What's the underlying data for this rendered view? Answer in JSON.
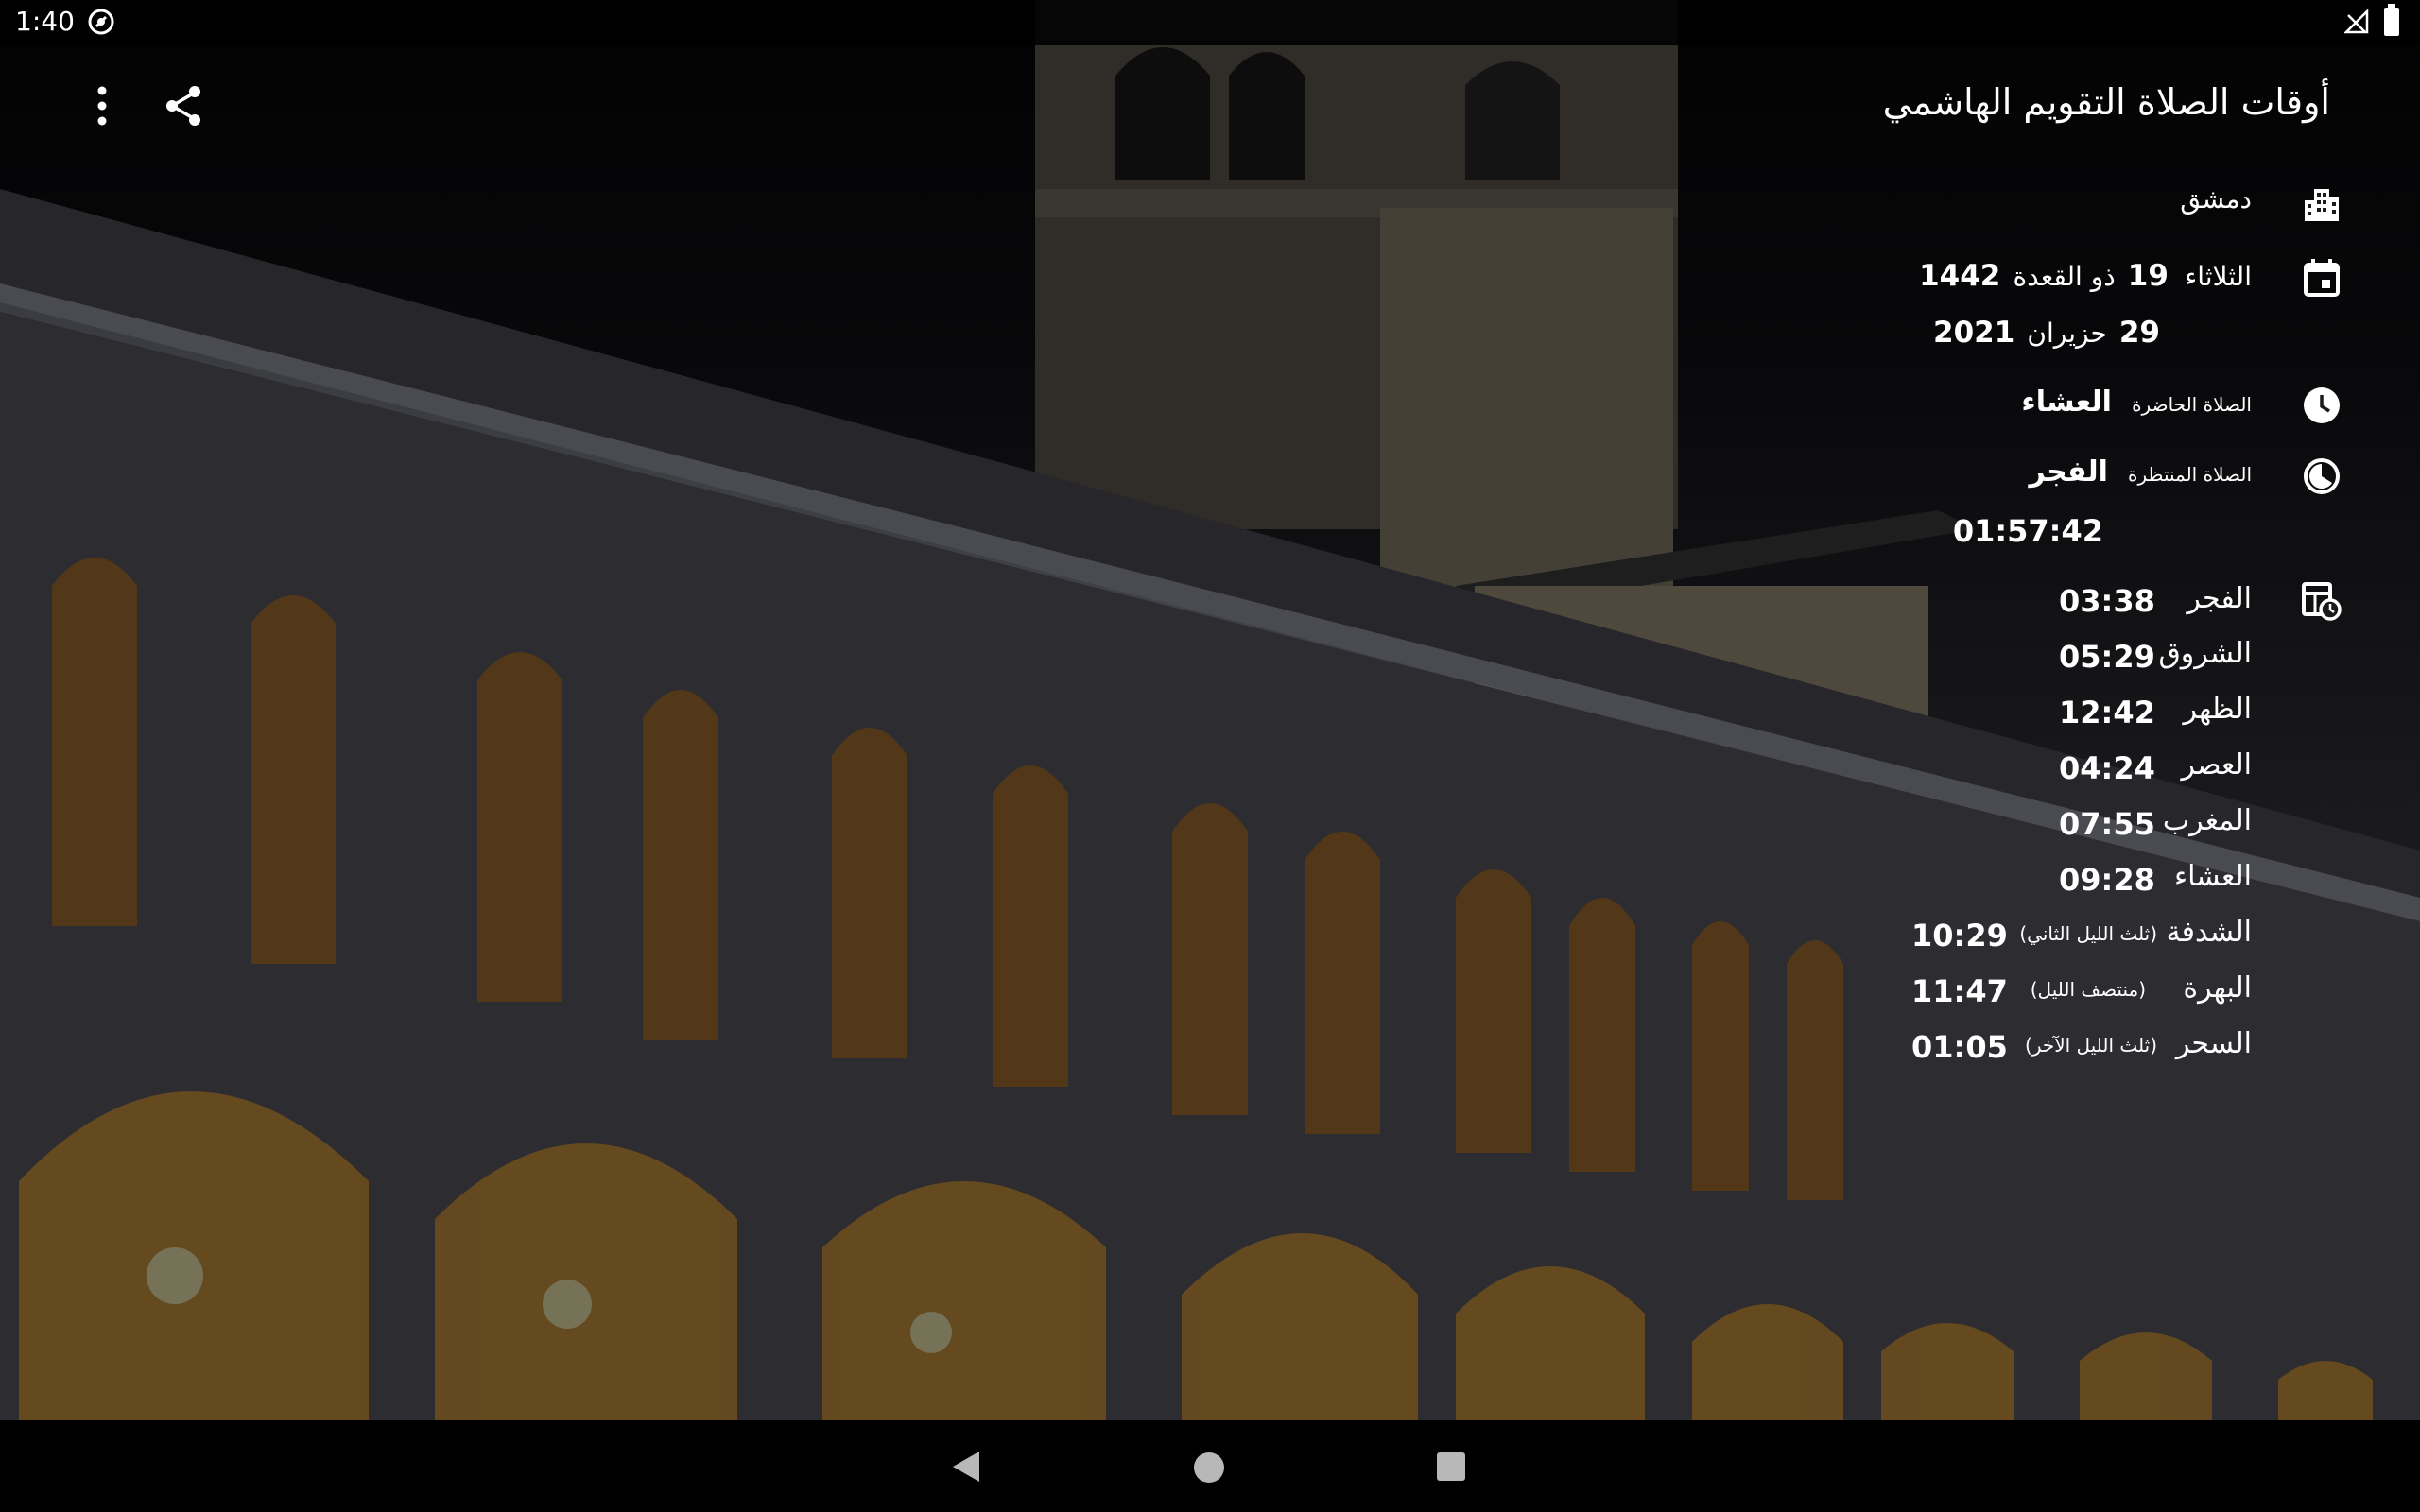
{
  "status": {
    "time": "1:40",
    "app_icon": "app-notification-icon",
    "signal_icon": "signal-off-icon",
    "battery_icon": "battery-full-icon"
  },
  "appbar": {
    "title": "أوقات الصلاة التقويم الهاشمي",
    "share_icon": "share-icon",
    "menu_icon": "more-vert-icon"
  },
  "info": {
    "city": "دمشق",
    "weekday": "الثلاثاء",
    "hijri_day": "19",
    "hijri_month": "ذو القعدة",
    "hijri_year": "1442",
    "gregorian_day": "29",
    "gregorian_month": "حزيران",
    "gregorian_year": "2021",
    "current_prayer_label": "الصلاة الحاضرة",
    "current_prayer": "العشاء",
    "next_prayer_label": "الصلاة المنتظرة",
    "next_prayer": "الفجر",
    "countdown": "01:57:42"
  },
  "prayers": [
    {
      "name": "الفجر",
      "note": "",
      "time": "03:38"
    },
    {
      "name": "الشروق",
      "note": "",
      "time": "05:29"
    },
    {
      "name": "الظهر",
      "note": "",
      "time": "12:42"
    },
    {
      "name": "العصر",
      "note": "",
      "time": "04:24"
    },
    {
      "name": "المغرب",
      "note": "",
      "time": "07:55"
    },
    {
      "name": "العشاء",
      "note": "",
      "time": "09:28"
    },
    {
      "name": "الشدفة",
      "note": "(ثلث الليل الثاني)",
      "time": "10:29"
    },
    {
      "name": "البهرة",
      "note": "(منتصف الليل)",
      "time": "11:47"
    },
    {
      "name": "السحر",
      "note": "(ثلث الليل الآخر)",
      "time": "01:05"
    }
  ],
  "colors": {
    "text": "#ffffff",
    "status_bar": "#000000",
    "nav_icons": "#b8b8b8"
  }
}
